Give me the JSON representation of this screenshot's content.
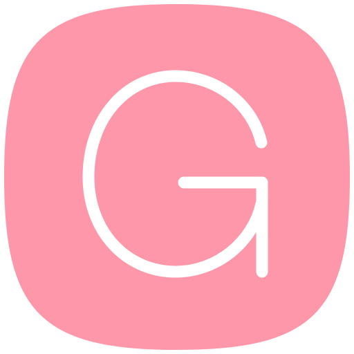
{
  "app_icon": {
    "name": "G",
    "background_color": "#FF97AB",
    "glyph_color": "#FFFFFF",
    "icon_shape": "squircle",
    "glyph": "letter-g-icon"
  }
}
